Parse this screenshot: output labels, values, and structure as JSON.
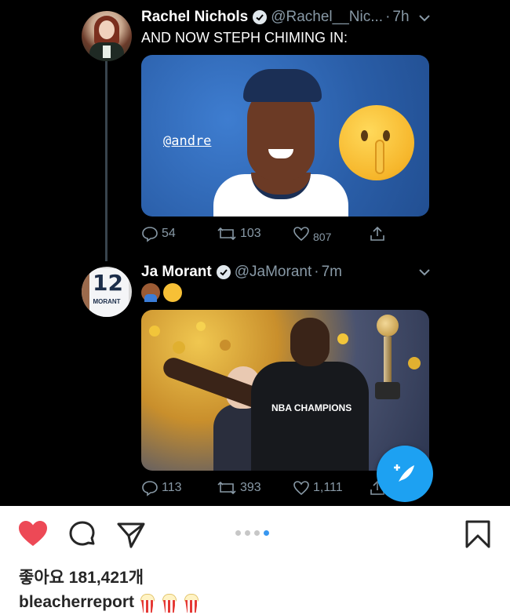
{
  "tweets": [
    {
      "name": "Rachel Nichols",
      "handle": "@Rachel__Nic...",
      "time": "7h",
      "text": "AND NOW STEPH CHIMING IN:",
      "media_caption": "@andre",
      "replies": "54",
      "retweets": "103",
      "likes": "807"
    },
    {
      "name": "Ja Morant",
      "handle": "@JaMorant",
      "time": "7m",
      "emojis": [
        "person-shrugging",
        "shushing-face"
      ],
      "avatar_number": "12",
      "avatar_name": "MORANT",
      "media_caption": "NBA CHAMPIONS",
      "replies": "113",
      "retweets": "393",
      "likes": "1,111"
    }
  ],
  "instagram": {
    "likes_text": "좋아요 181,421개",
    "username": "bleacherreport",
    "caption_emojis": [
      "popcorn",
      "popcorn",
      "popcorn"
    ],
    "carousel": {
      "total": 4,
      "active_index": 3
    }
  },
  "colors": {
    "twitter_bg": "#000000",
    "twitter_blue": "#1da1f2",
    "muted": "#8899a6",
    "heart_red": "#ed4956"
  }
}
